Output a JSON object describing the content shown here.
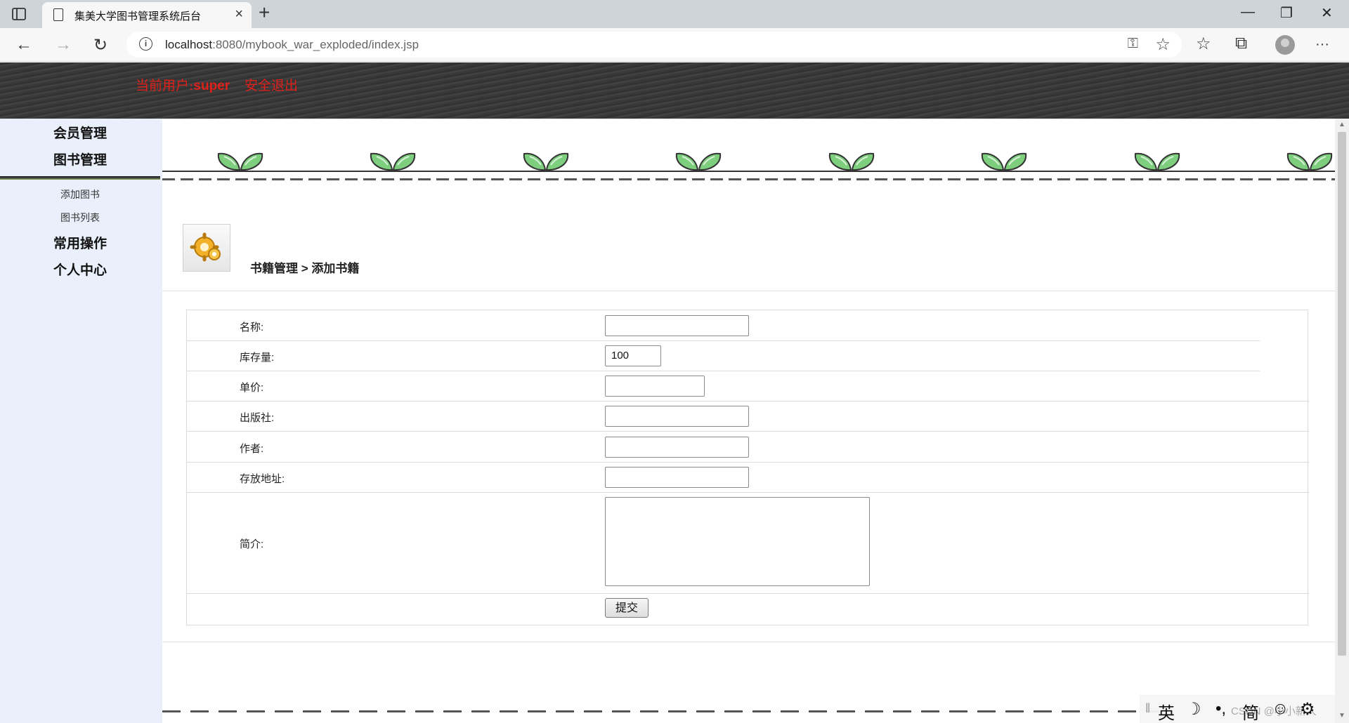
{
  "browser": {
    "tab_title": "集美大学图书管理系统后台",
    "tab_close": "×",
    "new_tab": "+",
    "url_host": "localhost",
    "url_path": ":8080/mybook_war_exploded/index.jsp",
    "window_buttons": {
      "minimize": "—",
      "restore": "❐",
      "close": "✕"
    },
    "nav": {
      "back": "←",
      "forward": "→",
      "reload": "↻"
    },
    "toolbar_icons": {
      "favorites": "☆",
      "collections": "⧉",
      "more": "···"
    }
  },
  "header": {
    "user_prefix": "当前用户:",
    "username": "super",
    "logout_label": "安全退出"
  },
  "sidebar": {
    "member_mgmt": "会员管理",
    "book_mgmt": "图书管理",
    "book_sub": [
      "添加图书",
      "图书列表"
    ],
    "common_ops": "常用操作",
    "personal_center": "个人中心"
  },
  "breadcrumb": "书籍管理 > 添加书籍",
  "form": {
    "fields": [
      {
        "label": "名称:",
        "value": ""
      },
      {
        "label": "库存量:",
        "value": "100"
      },
      {
        "label": "单价:",
        "value": ""
      },
      {
        "label": "出版社:",
        "value": ""
      },
      {
        "label": "作者:",
        "value": ""
      },
      {
        "label": "存放地址:",
        "value": ""
      }
    ],
    "intro_label": "简介:",
    "intro_value": "",
    "submit_label": "提交"
  },
  "ime": {
    "lang": "英",
    "moon": "☽",
    "punct": "•,",
    "simplified": "简",
    "emoji": "☺",
    "settings": "⚙",
    "watermark": "CSDN @小小新人"
  },
  "colors": {
    "header_text": "#e0201a",
    "sidebar_bg": "#eaf0fb",
    "sprout": "#7dce7d"
  }
}
